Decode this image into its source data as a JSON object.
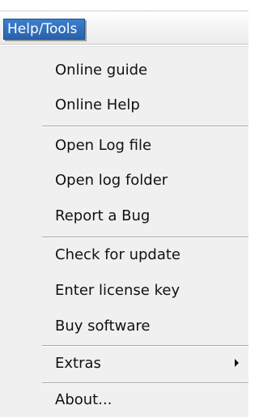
{
  "menubar": {
    "title": "Help/Tools"
  },
  "menu": {
    "items": [
      {
        "label": "Online guide"
      },
      {
        "label": "Online Help"
      },
      {
        "label": "Open Log file"
      },
      {
        "label": "Open log folder"
      },
      {
        "label": "Report a Bug"
      },
      {
        "label": "Check for update"
      },
      {
        "label": "Enter license key"
      },
      {
        "label": "Buy software"
      },
      {
        "label": "Extras",
        "submenu_icon": "chevron-right-icon"
      },
      {
        "label": "About..."
      }
    ]
  },
  "colors": {
    "menu_title_bg": "#2a62ab",
    "menu_title_text": "#ffffff",
    "menu_bg": "#f0f0f0",
    "separator": "#a9a9a9"
  }
}
